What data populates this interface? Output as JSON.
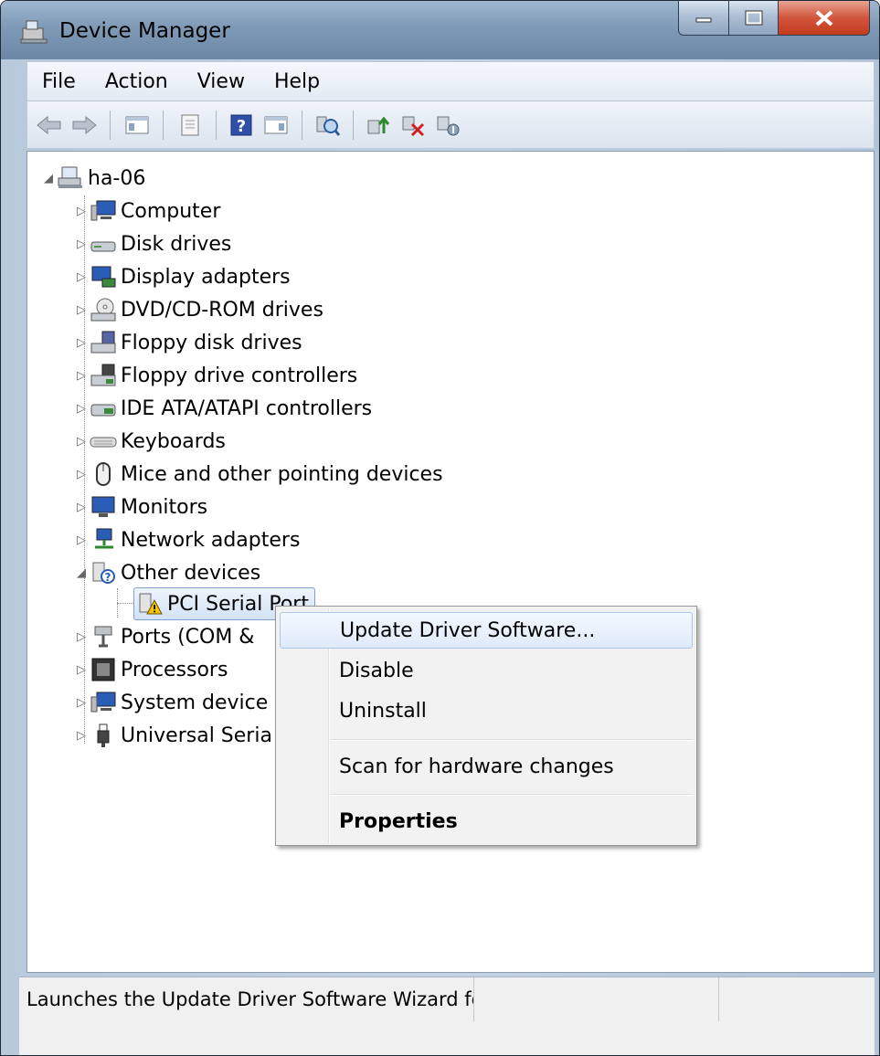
{
  "window": {
    "title": "Device Manager"
  },
  "menu": {
    "items": [
      "File",
      "Action",
      "View",
      "Help"
    ]
  },
  "toolbar": {
    "buttons": [
      "back-arrow-icon",
      "forward-arrow-icon",
      "show-hide-tree-icon",
      "properties-icon",
      "help-icon",
      "action-pane-icon",
      "scan-hardware-icon",
      "update-driver-icon",
      "uninstall-icon",
      "disable-icon"
    ]
  },
  "tree": {
    "root": "ha-06",
    "categories": [
      "Computer",
      "Disk drives",
      "Display adapters",
      "DVD/CD-ROM drives",
      "Floppy disk drives",
      "Floppy drive controllers",
      "IDE ATA/ATAPI controllers",
      "Keyboards",
      "Mice and other pointing devices",
      "Monitors",
      "Network adapters",
      "Other devices",
      "Ports (COM &",
      "Processors",
      "System device",
      "Universal Seria"
    ],
    "child": "PCI Serial Port"
  },
  "context_menu": {
    "items": [
      "Update Driver Software...",
      "Disable",
      "Uninstall",
      "Scan for hardware changes",
      "Properties"
    ]
  },
  "status": {
    "text": "Launches the Update Driver Software Wizard fc"
  },
  "colors": {
    "title_gradient": "#7f9ab6",
    "close_button": "#c43c1f",
    "selection": "#d3e3f6"
  }
}
